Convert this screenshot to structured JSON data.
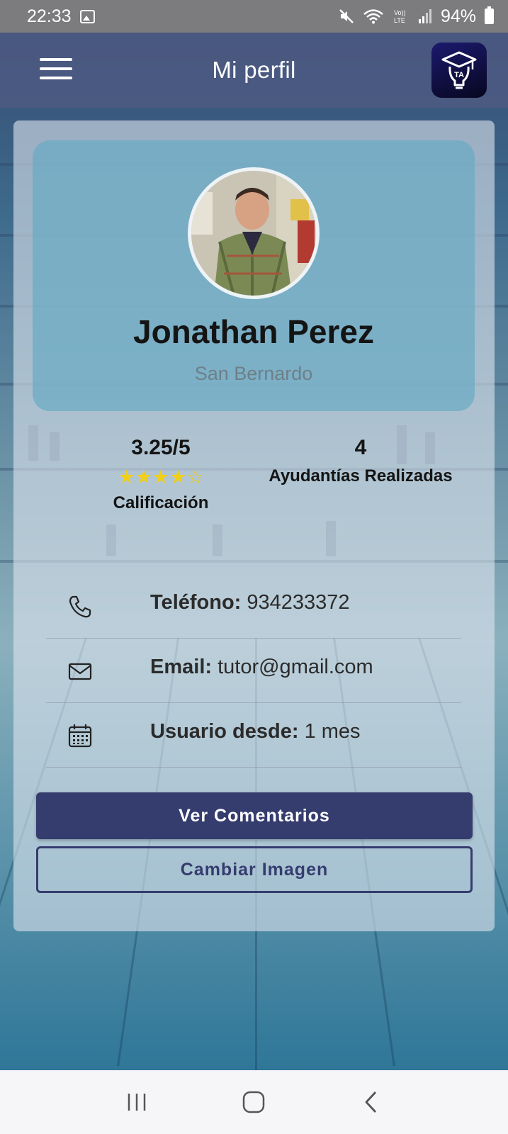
{
  "status_bar": {
    "time": "22:33",
    "battery": "94%",
    "icons": [
      "gallery-icon",
      "mute-icon",
      "wifi-icon",
      "volte-icon",
      "signal-icon",
      "battery-icon"
    ]
  },
  "app_bar": {
    "title": "Mi perfil",
    "menu_icon": "hamburger-menu-icon",
    "logo_text": "TA"
  },
  "profile": {
    "name": "Jonathan Perez",
    "location": "San Bernardo"
  },
  "stats": {
    "rating_value": "3.25/5",
    "rating_stars": "★★★★☆",
    "rating_score": 3.25,
    "rating_max": 5,
    "rating_label": "Calificación",
    "count_value": "4",
    "count_label": "Ayudantías Realizadas"
  },
  "info": [
    {
      "icon": "phone-icon",
      "label": "Teléfono:",
      "value": "934233372"
    },
    {
      "icon": "mail-icon",
      "label": "Email:",
      "value": "tutor@gmail.com"
    },
    {
      "icon": "calendar-icon",
      "label": "Usuario desde:",
      "value": "1 mes"
    }
  ],
  "buttons": {
    "comments": "Ver Comentarios",
    "change_image": "Cambiar Imagen"
  },
  "colors": {
    "primary": "#353c6e",
    "star": "#f2cf17",
    "header_panel": "#6aaac4"
  },
  "nav": {
    "icons": [
      "recent-apps-icon",
      "home-icon",
      "back-icon"
    ]
  }
}
